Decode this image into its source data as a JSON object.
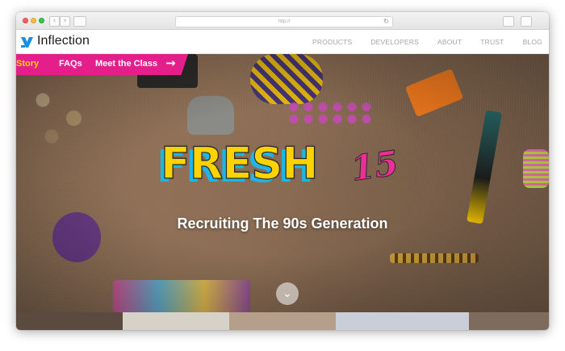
{
  "browser": {
    "url": "http://",
    "back_glyph": "‹",
    "forward_glyph": "›",
    "reload_glyph": "↻"
  },
  "site": {
    "brand": "Inflection",
    "brand_color": "#1a8fdd",
    "nav": [
      "PRODUCTS",
      "DEVELOPERS",
      "ABOUT",
      "TRUST",
      "BLOG"
    ]
  },
  "subnav": {
    "items": [
      "ur Story",
      "FAQs",
      "Meet the Class"
    ],
    "arrow": "→",
    "accent": "#e41f8c"
  },
  "hero": {
    "title": "FRESH",
    "title_number": "15",
    "tagline": "Recruiting The 90s Generation",
    "scroll_glyph": "⌄"
  }
}
